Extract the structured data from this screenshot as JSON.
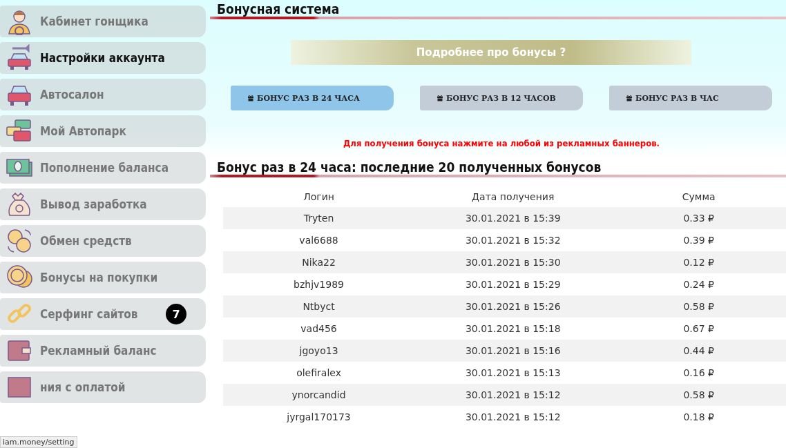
{
  "sidebar": {
    "items": [
      {
        "label": "Кабинет гонщика",
        "selected": false
      },
      {
        "label": "Настройки аккаунта",
        "selected": true
      },
      {
        "label": "Автосалон",
        "selected": false
      },
      {
        "label": "Мой Автопарк",
        "selected": false
      },
      {
        "label": "Пополнение баланса",
        "selected": false
      },
      {
        "label": "Вывод заработка",
        "selected": false
      },
      {
        "label": "Обмен средств",
        "selected": false
      },
      {
        "label": "Бонусы на покупки",
        "selected": false
      },
      {
        "label": "Серфинг сайтов",
        "selected": false,
        "badge": "7"
      },
      {
        "label": "Рекламный баланс",
        "selected": false
      },
      {
        "label": "ния с оплатой",
        "selected": false
      }
    ]
  },
  "status_url": "iam.money/setting",
  "page_title": "Бонусная система",
  "more_link": "Подробнее про бонусы ?",
  "bonus_tabs": [
    {
      "label": "БОНУС РАЗ В 24 ЧАСА",
      "selected": true
    },
    {
      "label": "БОНУС РАЗ В 12 ЧАСОВ",
      "selected": false
    },
    {
      "label": "БОНУС РАЗ В ЧАС",
      "selected": false
    }
  ],
  "notice": "Для получения бонуса нажмите на любой из рекламных баннеров.",
  "section_title": "Бонус раз в 24 часа: последние 20 полученных бонусов",
  "table": {
    "columns": [
      "Логин",
      "Дата получения",
      "Сумма"
    ],
    "rows": [
      [
        "Tryten",
        "30.01.2021 в 15:39",
        "0.33 ₽"
      ],
      [
        "val6688",
        "30.01.2021 в 15:32",
        "0.39 ₽"
      ],
      [
        "Nika22",
        "30.01.2021 в 15:30",
        "0.12 ₽"
      ],
      [
        "bzhjv1989",
        "30.01.2021 в 15:29",
        "0.24 ₽"
      ],
      [
        "Ntbyct",
        "30.01.2021 в 15:26",
        "0.58 ₽"
      ],
      [
        "vad456",
        "30.01.2021 в 15:18",
        "0.67 ₽"
      ],
      [
        "jgoyo13",
        "30.01.2021 в 15:16",
        "0.44 ₽"
      ],
      [
        "olefiralex",
        "30.01.2021 в 15:13",
        "0.16 ₽"
      ],
      [
        "ynorcandid",
        "30.01.2021 в 15:12",
        "0.58 ₽"
      ],
      [
        "jyrgal170173",
        "30.01.2021 в 15:12",
        "0.18 ₽"
      ]
    ]
  }
}
